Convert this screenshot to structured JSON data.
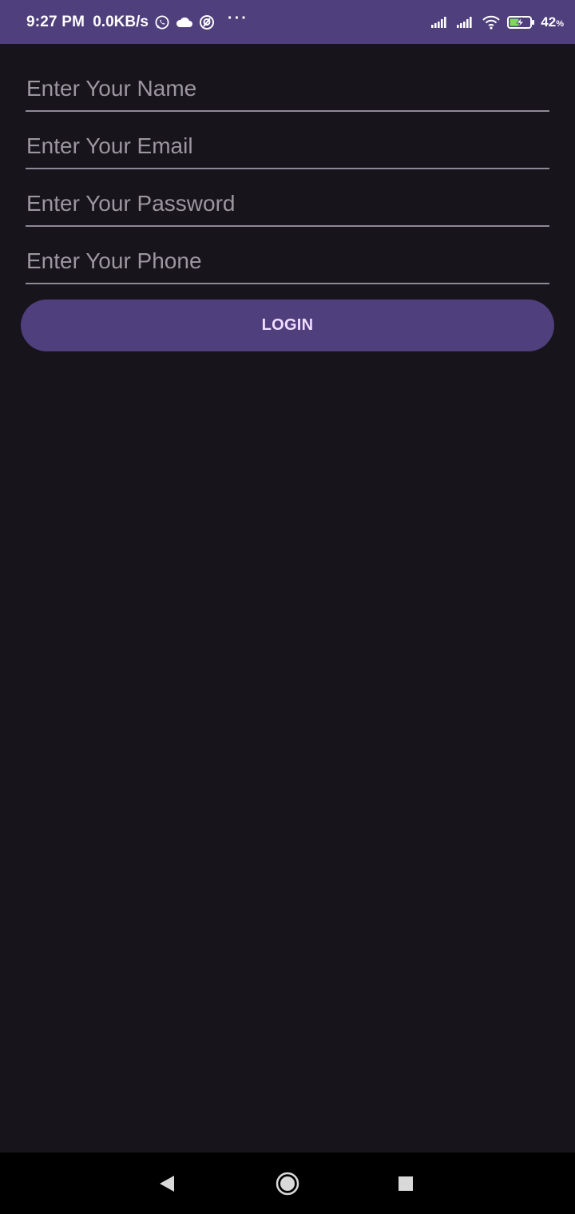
{
  "status_bar": {
    "time": "9:27 PM",
    "net_speed": "0.0KB/s",
    "left_icons": [
      "whatsapp-icon",
      "cloud-icon",
      "vpn-icon",
      "more-notifications-icon"
    ],
    "overflow_dots": "···",
    "right_icons": [
      "signal-icon",
      "signal-icon",
      "wifi-icon",
      "battery-charging-icon"
    ],
    "battery_value": "42",
    "battery_unit": "%",
    "background": "#4f3f7c"
  },
  "form": {
    "name_placeholder": "Enter Your Name",
    "email_placeholder": "Enter Your Email",
    "password_placeholder": "Enter Your Password",
    "phone_placeholder": "Enter Your Phone",
    "login_label": "LOGIN"
  },
  "nav_bar": {
    "buttons": [
      "back-icon",
      "home-icon",
      "recents-icon"
    ]
  },
  "colors": {
    "background": "#17141c",
    "accent": "#4f3f7c",
    "button_text": "#f1ddff",
    "underline": "#8e8996"
  }
}
